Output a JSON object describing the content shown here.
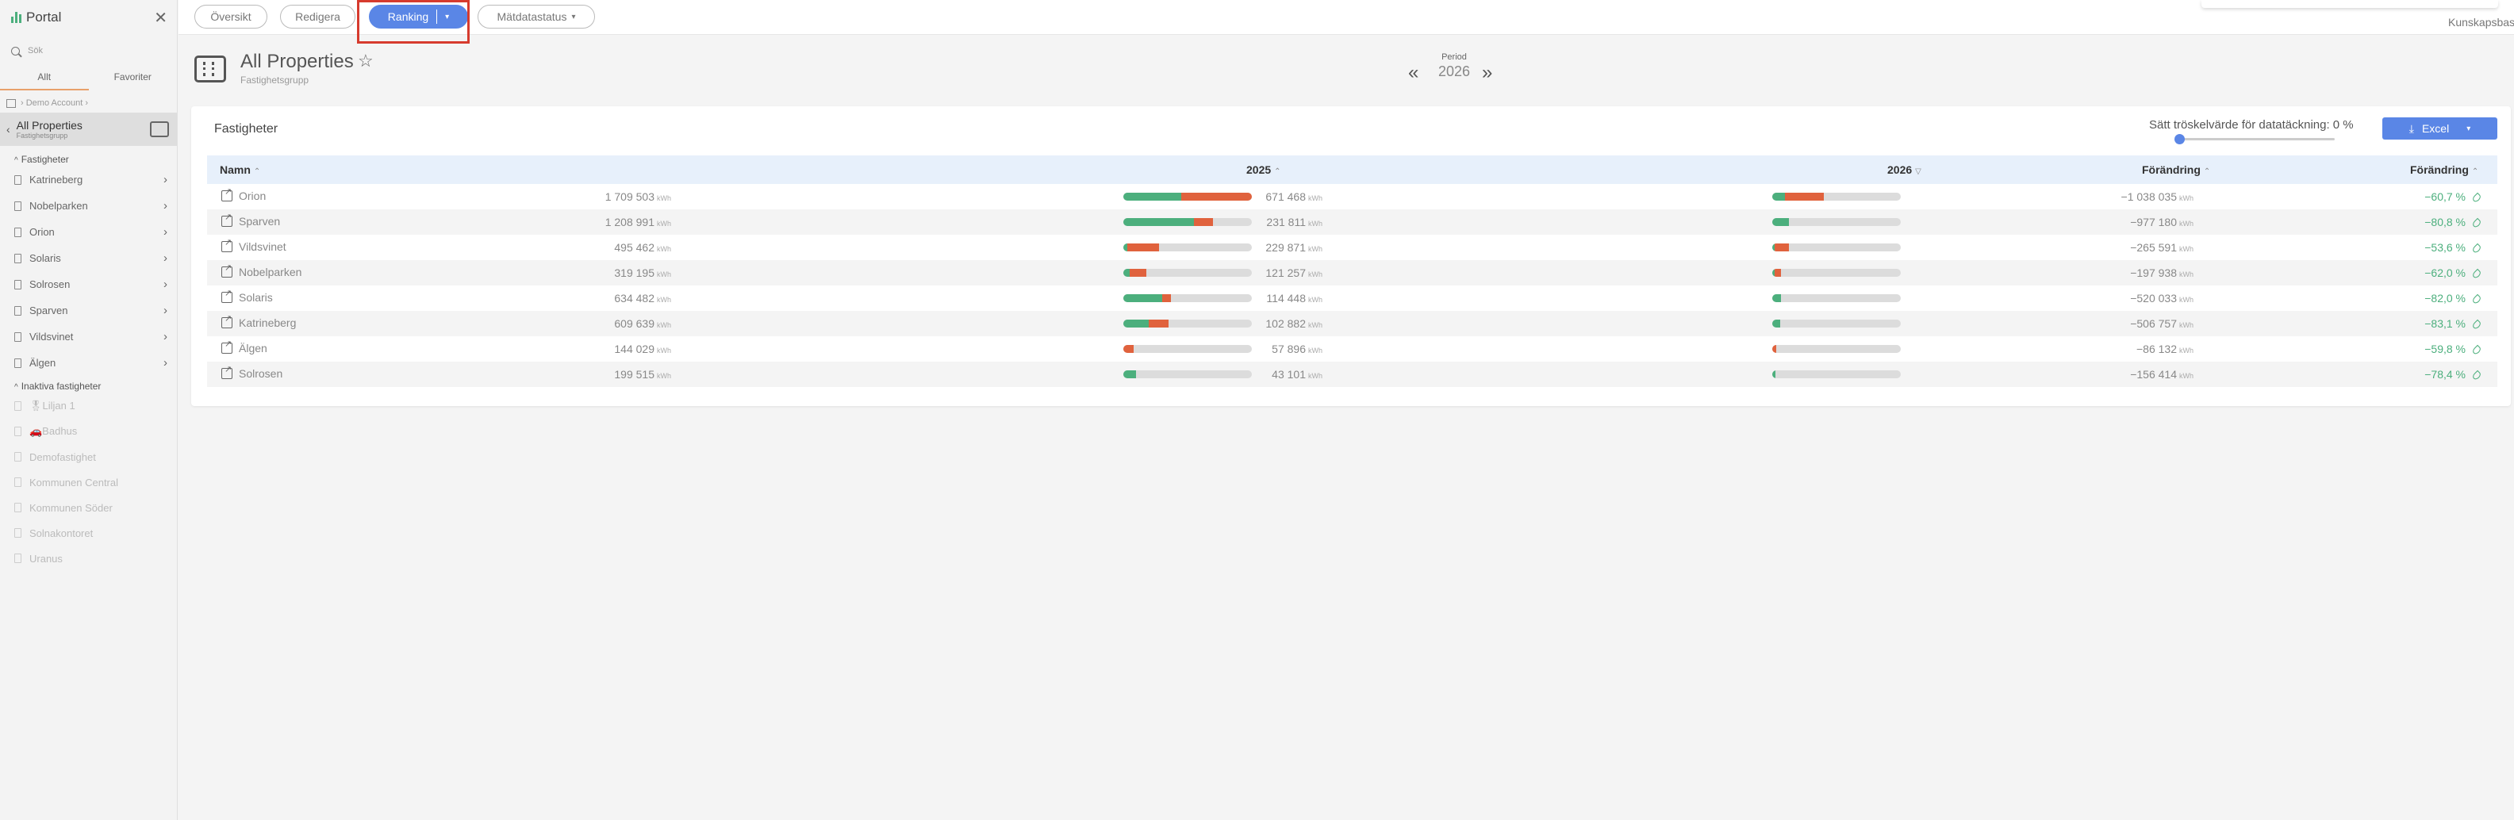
{
  "sidebar": {
    "title": "Portal",
    "search_placeholder": "Sök",
    "tabs": [
      "Allt",
      "Favoriter"
    ],
    "breadcrumb": "Demo Account",
    "selected": {
      "title": "All Properties",
      "subtitle": "Fastighetsgrupp"
    },
    "active_section": "Fastigheter",
    "active_items": [
      "Katrineberg",
      "Nobelparken",
      "Orion",
      "Solaris",
      "Solrosen",
      "Sparven",
      "Vildsvinet",
      "Älgen"
    ],
    "inactive_section": "Inaktiva fastigheter",
    "inactive_items": [
      "🎖Liljan 1",
      "🚗Badhus",
      "Demofastighet",
      "Kommunen Central",
      "Kommunen Söder",
      "Solnakontoret",
      "Uranus"
    ]
  },
  "toolbar": {
    "overview": "Översikt",
    "edit": "Redigera",
    "ranking": "Ranking",
    "status": "Mätdatastatus",
    "help_link": "Kunskapsbas"
  },
  "header": {
    "title": "All Properties",
    "subtitle": "Fastighetsgrupp",
    "period_label": "Period",
    "period_year": "2026"
  },
  "card": {
    "title": "Fastigheter",
    "threshold_label": "Sätt tröskelvärde för datatäckning: 0 %",
    "threshold_value": 0,
    "excel": "Excel"
  },
  "table": {
    "headers": [
      "Namn",
      "2025",
      "2026",
      "Förändring",
      "Förändring"
    ],
    "unit": "kWh",
    "rows": [
      {
        "name": "Orion",
        "y2025": "1 709 503",
        "y2026": "671 468",
        "diff": "−1 038 035",
        "pct": "−60,7 %",
        "b25": [
          0.45,
          0.55
        ],
        "b26": [
          0.1,
          0.3
        ]
      },
      {
        "name": "Sparven",
        "y2025": "1 208 991",
        "y2026": "231 811",
        "diff": "−977 180",
        "pct": "−80,8 %",
        "b25": [
          0.55,
          0.15
        ],
        "b26": [
          0.13,
          0.0
        ]
      },
      {
        "name": "Vildsvinet",
        "y2025": "495 462",
        "y2026": "229 871",
        "diff": "−265 591",
        "pct": "−53,6 %",
        "b25": [
          0.03,
          0.25
        ],
        "b26": [
          0.02,
          0.11
        ]
      },
      {
        "name": "Nobelparken",
        "y2025": "319 195",
        "y2026": "121 257",
        "diff": "−197 938",
        "pct": "−62,0 %",
        "b25": [
          0.05,
          0.13
        ],
        "b26": [
          0.02,
          0.05
        ]
      },
      {
        "name": "Solaris",
        "y2025": "634 482",
        "y2026": "114 448",
        "diff": "−520 033",
        "pct": "−82,0 %",
        "b25": [
          0.3,
          0.07
        ],
        "b26": [
          0.07,
          0.0
        ]
      },
      {
        "name": "Katrineberg",
        "y2025": "609 639",
        "y2026": "102 882",
        "diff": "−506 757",
        "pct": "−83,1 %",
        "b25": [
          0.2,
          0.15
        ],
        "b26": [
          0.06,
          0.0
        ]
      },
      {
        "name": "Älgen",
        "y2025": "144 029",
        "y2026": "57 896",
        "diff": "−86 132",
        "pct": "−59,8 %",
        "b25": [
          0.0,
          0.08
        ],
        "b26": [
          0.0,
          0.03
        ]
      },
      {
        "name": "Solrosen",
        "y2025": "199 515",
        "y2026": "43 101",
        "diff": "−156 414",
        "pct": "−78,4 %",
        "b25": [
          0.1,
          0.0
        ],
        "b26": [
          0.025,
          0.0
        ]
      }
    ]
  },
  "colors": {
    "accent": "#5a86e6",
    "good": "#4caf7d",
    "bad": "#e0623d",
    "highlight": "#d63b2e"
  }
}
